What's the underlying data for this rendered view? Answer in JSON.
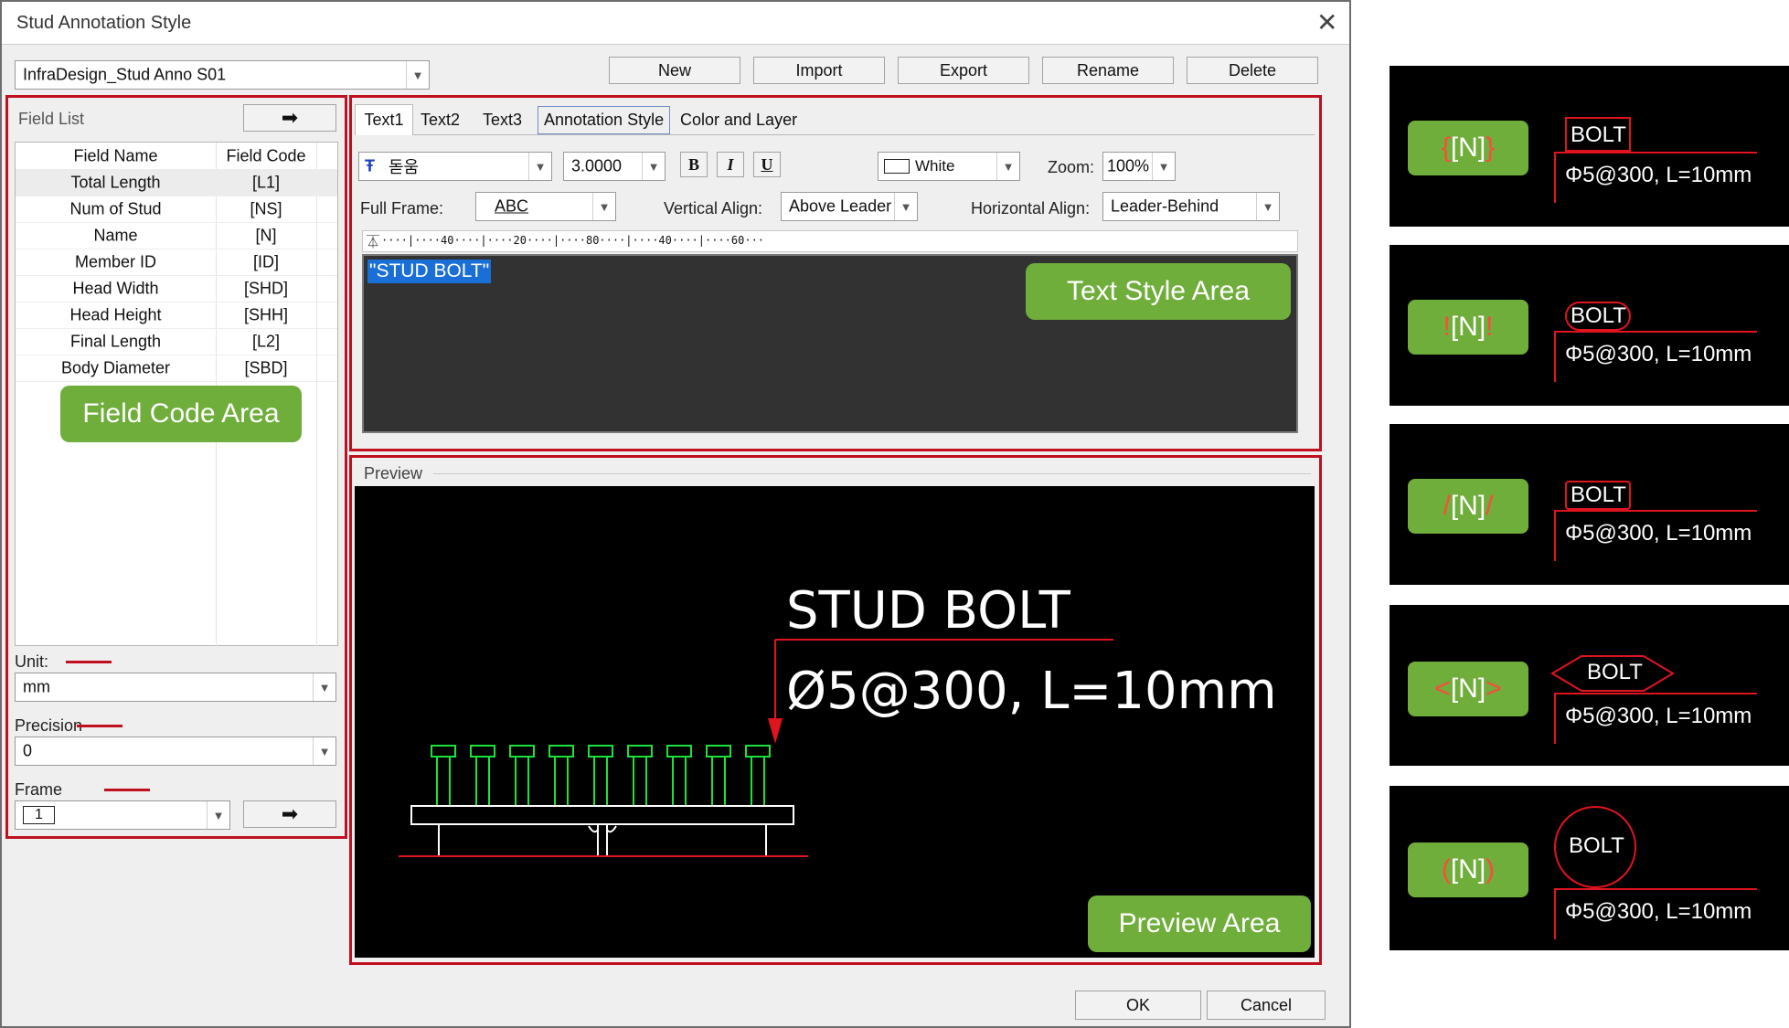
{
  "window": {
    "title": "Stud Annotation Style",
    "close_glyph": "✕"
  },
  "style_select": {
    "value": "InfraDesign_Stud Anno S01"
  },
  "toolbar": {
    "new": "New",
    "import": "Import",
    "export": "Export",
    "rename": "Rename",
    "delete": "Delete"
  },
  "field_list": {
    "label": "Field List",
    "headers": {
      "name": "Field Name",
      "code": "Field Code"
    },
    "rows": [
      {
        "name": "Total Length",
        "code": "[L1]"
      },
      {
        "name": "Num of Stud",
        "code": "[NS]"
      },
      {
        "name": "Name",
        "code": "[N]"
      },
      {
        "name": "Member ID",
        "code": "[ID]"
      },
      {
        "name": "Head Width",
        "code": "[SHD]"
      },
      {
        "name": "Head Height",
        "code": "[SHH]"
      },
      {
        "name": "Final Length",
        "code": "[L2]"
      },
      {
        "name": "Body Diameter",
        "code": "[SBD]"
      }
    ]
  },
  "unit": {
    "label": "Unit:",
    "value": "mm"
  },
  "precision": {
    "label": "Precision",
    "value": "0"
  },
  "frame": {
    "label": "Frame",
    "value": "1"
  },
  "tabs": [
    "Text1",
    "Text2",
    "Text3",
    "Annotation Style",
    "Color and Layer"
  ],
  "text_style": {
    "font": "돋움",
    "height": "3.0000",
    "bold": "B",
    "italic": "I",
    "underline": "U",
    "color": "White",
    "zoom_label": "Zoom:",
    "zoom": "100%",
    "full_frame_label": "Full Frame:",
    "full_frame": "ABC",
    "vertical_align_label": "Vertical Align:",
    "vertical_align": "Above Leader",
    "horizontal_align_label": "Horizontal Align:",
    "horizontal_align": "Leader-Behind",
    "ruler_text": "····|····40····|····20····|····80····|····40····|····60···",
    "editor_text": "\"STUD BOLT\""
  },
  "preview": {
    "label": "Preview",
    "title": "STUD BOLT",
    "subtitle": "Ø5@300, L=10mm"
  },
  "callouts": {
    "field": "Field Code Area",
    "text": "Text Style Area",
    "preview": "Preview Area"
  },
  "footer": {
    "ok": "OK",
    "cancel": "Cancel"
  },
  "examples": [
    {
      "open": "{",
      "name": "[N]",
      "close": "}",
      "bolt": "BOLT",
      "spec": "Φ5@300, L=10mm",
      "frame": "rect"
    },
    {
      "open": "!",
      "name": "[N]",
      "close": "!",
      "bolt": "BOLT",
      "spec": "Φ5@300, L=10mm",
      "frame": "rounded"
    },
    {
      "open": "/",
      "name": "[N]",
      "close": "/",
      "bolt": "BOLT",
      "spec": "Φ5@300, L=10mm",
      "frame": "rect"
    },
    {
      "open": "<",
      "name": "[N]",
      "close": ">",
      "bolt": "BOLT",
      "spec": "Φ5@300, L=10mm",
      "frame": "diamond"
    },
    {
      "open": "(",
      "name": "[N]",
      "close": ")",
      "bolt": "BOLT",
      "spec": "Φ5@300, L=10mm",
      "frame": "circle"
    }
  ],
  "colors": {
    "accent_red": "#c0101f",
    "callout_green": "#6fae3a",
    "preview_green": "#18e23b",
    "preview_red": "#e0141e",
    "select_blue": "#1a6fd6"
  }
}
